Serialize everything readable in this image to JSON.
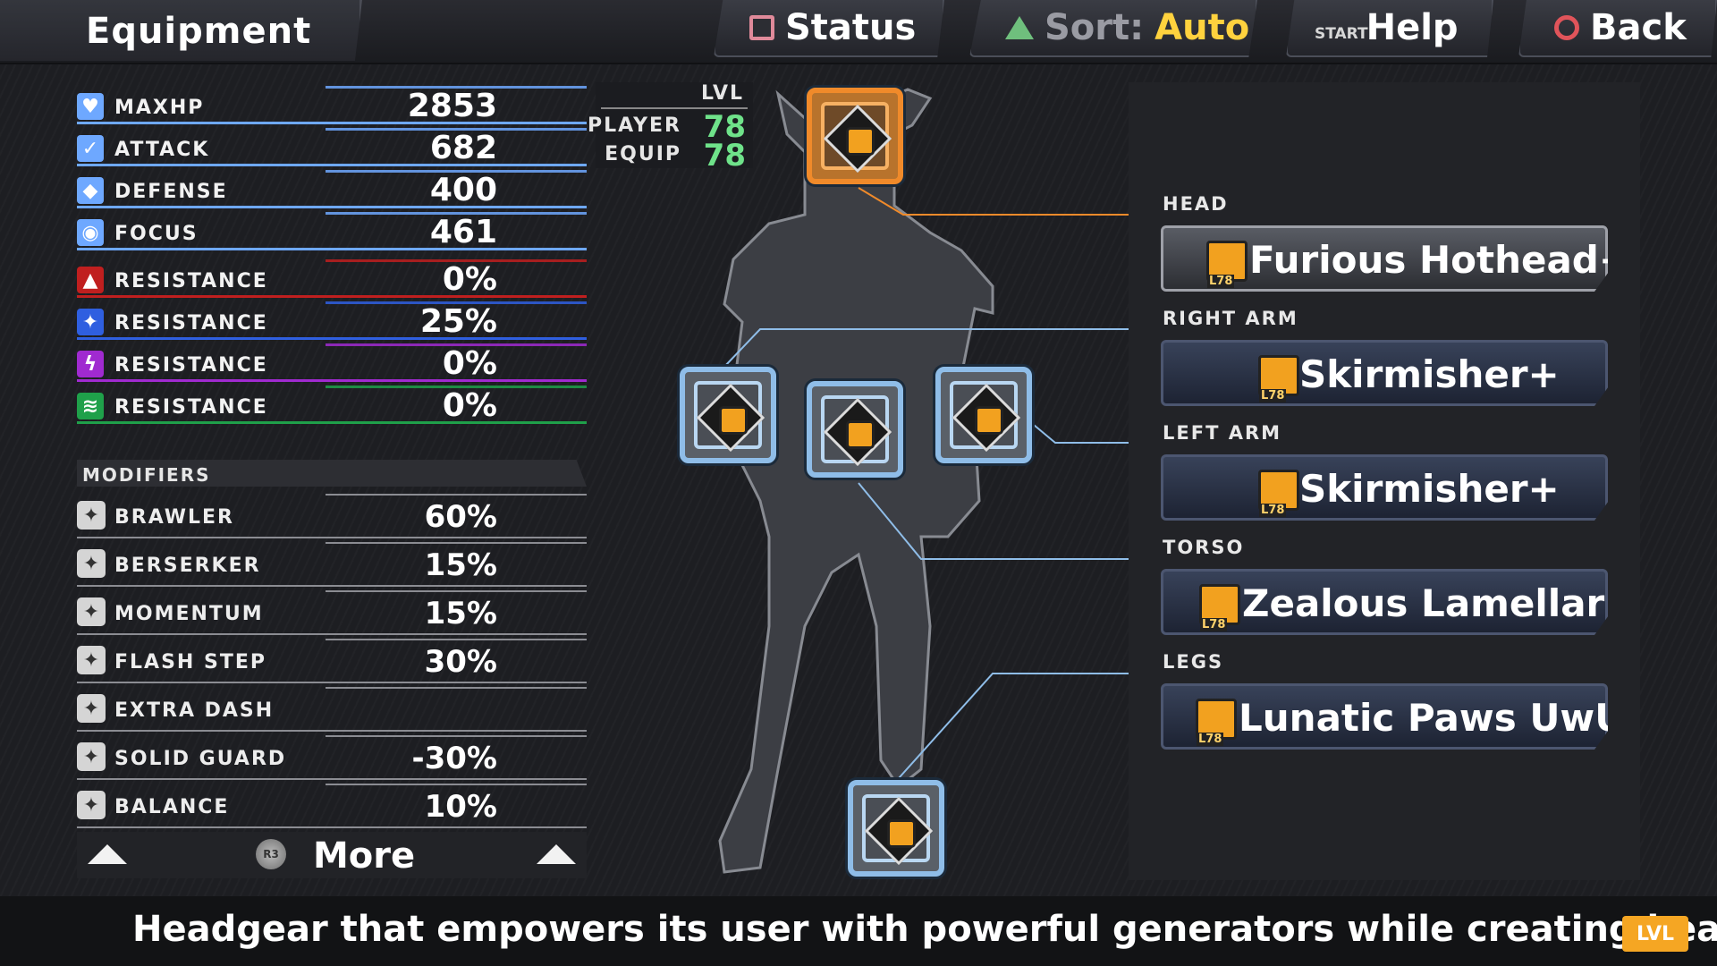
{
  "header": {
    "title": "Equipment",
    "buttons": {
      "status": "Status",
      "sort_label": "Sort:",
      "sort_value": "Auto",
      "start_glyph": "START",
      "help": "Help",
      "back": "Back"
    }
  },
  "stats": [
    {
      "label": "MAXHP",
      "value": "2853",
      "icon": "heart-icon",
      "color": "#6ea8ff"
    },
    {
      "label": "ATTACK",
      "value": "682",
      "icon": "sword-icon",
      "color": "#6ea8ff"
    },
    {
      "label": "DEFENSE",
      "value": "400",
      "icon": "shield-icon",
      "color": "#6ea8ff"
    },
    {
      "label": "FOCUS",
      "value": "461",
      "icon": "eye-icon",
      "color": "#6ea8ff"
    },
    {
      "label": "RESISTANCE",
      "value": "0%",
      "icon": "heat-element-icon",
      "color": "#c01f1f"
    },
    {
      "label": "RESISTANCE",
      "value": "25%",
      "icon": "cold-element-icon",
      "color": "#2f5fe0"
    },
    {
      "label": "RESISTANCE",
      "value": "0%",
      "icon": "shock-element-icon",
      "color": "#a02ad0"
    },
    {
      "label": "RESISTANCE",
      "value": "0%",
      "icon": "wave-element-icon",
      "color": "#1fa04a"
    }
  ],
  "modifiers": {
    "header": "MODIFIERS",
    "items": [
      {
        "label": "BRAWLER",
        "value": "60%",
        "icon": "fist-icon"
      },
      {
        "label": "BERSERKER",
        "value": "15%",
        "icon": "berserker-icon"
      },
      {
        "label": "MOMENTUM",
        "value": "15%",
        "icon": "momentum-icon"
      },
      {
        "label": "FLASH STEP",
        "value": "30%",
        "icon": "flash-step-icon"
      },
      {
        "label": "EXTRA DASH",
        "value": "",
        "icon": "dash-icon"
      },
      {
        "label": "SOLID GUARD",
        "value": "-30%",
        "icon": "guard-icon"
      },
      {
        "label": "BALANCE",
        "value": "10%",
        "icon": "balance-icon"
      }
    ]
  },
  "more": {
    "label": "More",
    "button_glyph": "R3"
  },
  "level": {
    "header": "LVL",
    "player_label": "PLAYER",
    "player_value": "78",
    "equip_label": "EQUIP",
    "equip_value": "78"
  },
  "equipment": [
    {
      "part": "HEAD",
      "name": "Furious Hothead+",
      "level": "L78",
      "selected": true
    },
    {
      "part": "RIGHT ARM",
      "name": "Skirmisher+",
      "level": "L78",
      "selected": false
    },
    {
      "part": "LEFT ARM",
      "name": "Skirmisher+",
      "level": "L78",
      "selected": false
    },
    {
      "part": "TORSO",
      "name": "Zealous Lamellar+",
      "level": "L78",
      "selected": false
    },
    {
      "part": "LEGS",
      "name": "Lunatic Paws UwU",
      "level": "L78",
      "selected": false
    }
  ],
  "description": {
    "text": "Headgear that empowers its user with powerful generators while creating heat.",
    "badge": "LVL"
  },
  "colors": {
    "accent_orange": "#f08a2a",
    "slot_blue": "#8fbde8",
    "level_green": "#6fe28a",
    "sort_yellow": "#ffd23e"
  }
}
